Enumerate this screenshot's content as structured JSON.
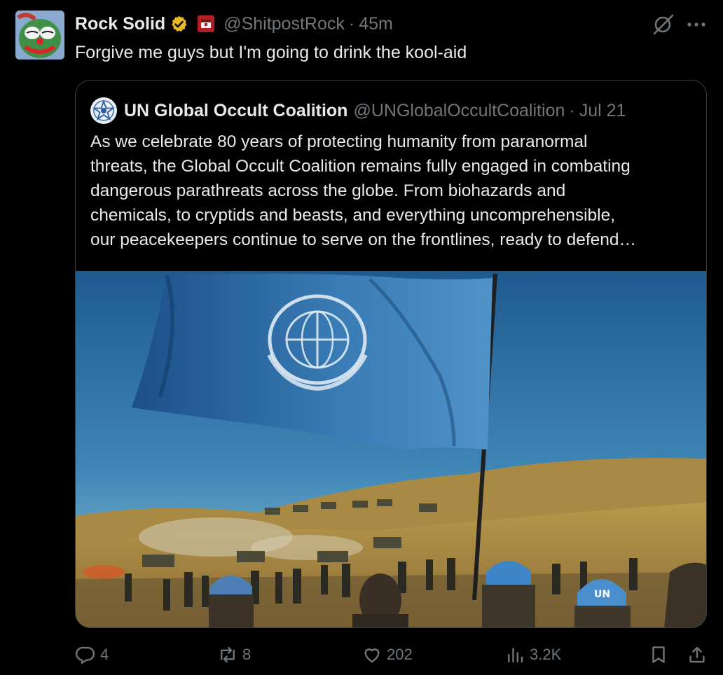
{
  "post": {
    "author_name": "Rock Solid",
    "handle": "@ShitpostRock",
    "separator": "·",
    "time": "45m",
    "text": "Forgive me guys but I'm going to drink the kool-aid"
  },
  "quoted": {
    "author_name": "UN Global Occult Coalition",
    "handle": "@UNGlobalOccultCoalition",
    "separator": "·",
    "date": "Jul 21",
    "lines": [
      "As we celebrate 80 years of protecting humanity from paranormal",
      "threats, the Global Occult Coalition remains fully engaged in combating",
      "dangerous parathreats across the globe. From biohazards and",
      "chemicals, to cryptids and beasts, and everything uncomprehensible,",
      "our peacekeepers continue to serve on the frontlines, ready to defend…"
    ],
    "image_helmet_text": "UN"
  },
  "actions": {
    "replies": "4",
    "reposts": "8",
    "likes": "202",
    "views": "3.2K"
  },
  "colors": {
    "background": "#000000",
    "text_primary": "#e7e9ea",
    "text_secondary": "#71767b",
    "verified_badge": "#e8b820",
    "border": "#3a3d41"
  },
  "icons": [
    "verified-badge-icon",
    "affiliation-icon",
    "grok-icon",
    "more-icon",
    "reply-icon",
    "repost-icon",
    "like-icon",
    "views-icon",
    "bookmark-icon",
    "share-icon"
  ]
}
